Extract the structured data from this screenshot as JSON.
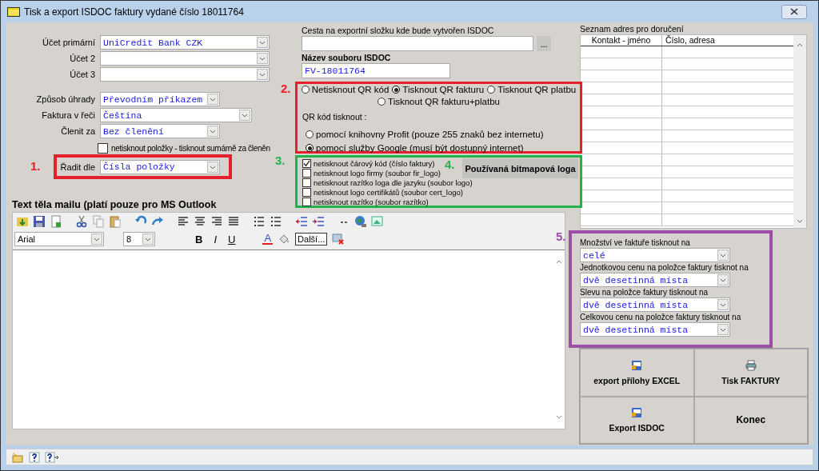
{
  "window": {
    "title": "Tisk a export ISDOC faktury vydané číslo 18011764"
  },
  "accounts": [
    {
      "label": "Účet primární",
      "value": "UniCredit Bank CZK"
    },
    {
      "label": "Účet 2"
    },
    {
      "label": "Účet 3"
    }
  ],
  "payment_fields": [
    {
      "label": "Způsob úhrady",
      "value": "Převodním příkazem"
    },
    {
      "label": "Faktura v řeči",
      "value": "Čeština"
    },
    {
      "label": "Členit za",
      "value": "Bez členění"
    }
  ],
  "summary_checkbox": {
    "label": "netisknout položky - tisknout sumárně za členěn",
    "checked": false
  },
  "sort": {
    "annotation": {
      "label": "1.",
      "color": "#e3202b"
    },
    "label": "Řadit dle",
    "value": "Čísla položky"
  },
  "export_path": {
    "label": "Cesta na exportní složku kde bude vytvořen ISDOC",
    "browse": "..."
  },
  "file_name": {
    "label": "Název souboru ISDOC",
    "value": "FV-18011764"
  },
  "qr": {
    "annotation": {
      "label": "2.",
      "color": "#e3202b"
    },
    "options": [
      {
        "label": "Netisknout QR kód",
        "selected": false
      },
      {
        "label": "Tisknout QR fakturu",
        "selected": true
      },
      {
        "label": "Tisknout QR platbu",
        "selected": false
      },
      {
        "label": "Tisknout QR fakturu+platbu",
        "selected": false
      }
    ],
    "method_title": "QR kód tisknout :",
    "methods": [
      {
        "label": "pomocí knihovny Profit (pouze 255 znaků  bez internetu)",
        "selected": false
      },
      {
        "label": "pomocí služby Google (musí být dostupný internet)",
        "selected": true
      }
    ]
  },
  "logos": {
    "annotation": {
      "label": "3.",
      "color": "#22b24c"
    },
    "checkboxes": [
      {
        "label": "netisknout čárový kód (číslo faktury)",
        "checked": true
      },
      {
        "label": "netisknout logo firmy (soubor fir_logo)",
        "checked": false
      },
      {
        "label": "netisknout razítko loga dle jazyku (soubor logo)",
        "checked": false
      },
      {
        "label": "netisknout logo certifikátů (soubor cert_logo)",
        "checked": false
      },
      {
        "label": "netisknout razítko (soubor razítko)",
        "checked": false
      }
    ],
    "button_annotation": {
      "label": "4.",
      "color": "#22b24c"
    },
    "button": "Používaná bitmapová loga"
  },
  "address_list": {
    "title": "Seznam adres pro doručení",
    "columns": [
      "Kontakt - jméno",
      "Číslo, adresa"
    ]
  },
  "mail_text": {
    "title": "Text těla mailu (platí pouze pro MS Outlook",
    "font": "Arial",
    "size": "8",
    "bold": "B",
    "italic": "I",
    "underline": "U",
    "font_color": "A",
    "more": "Další..."
  },
  "rounding": {
    "annotation": {
      "label": "5.",
      "color": "#9b4fa5"
    },
    "fields": [
      {
        "label": "Množství ve faktuře tisknout na",
        "value": "celé"
      },
      {
        "label": "Jednotkovou cenu na položce faktury tisknot na",
        "value": "dvě desetinná místa"
      },
      {
        "label": "Slevu na položce faktury tisknout na",
        "value": "dvě desetinná místa"
      },
      {
        "label": "Celkovou cenu na položce faktury tisknout na",
        "value": "dvě desetinná místa"
      }
    ]
  },
  "actions": [
    {
      "label": "export přílohy EXCEL",
      "kind": "export"
    },
    {
      "label": "Export ISDOC",
      "kind": "export"
    },
    {
      "label": "Tisk FAKTURY",
      "kind": "print"
    },
    {
      "label": "Konec",
      "kind": "plain"
    }
  ]
}
